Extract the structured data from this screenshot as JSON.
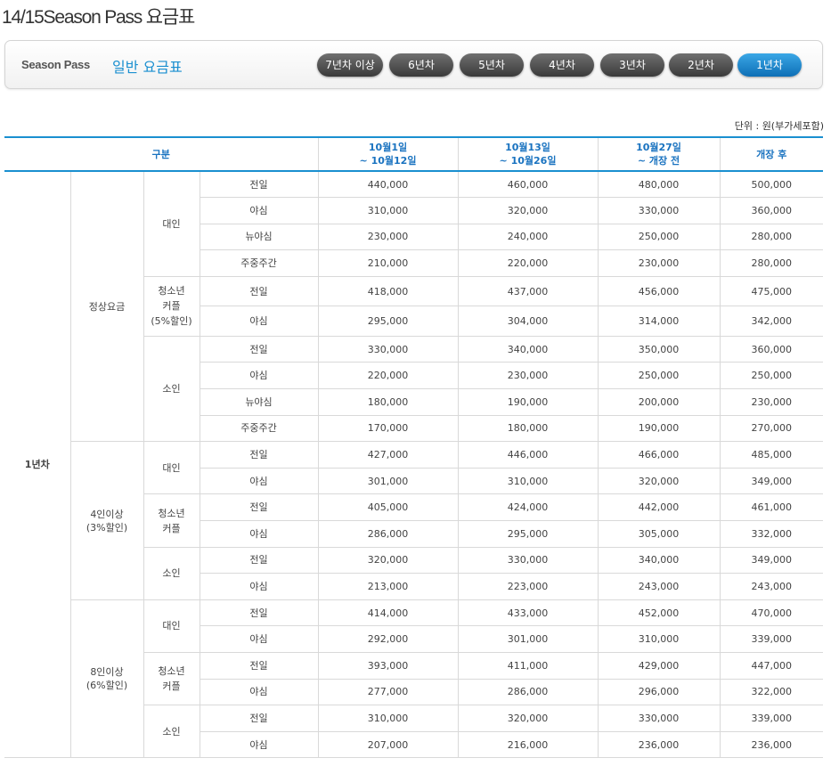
{
  "page_title": "14/15Season Pass 요금표",
  "bar": {
    "season_pass": "Season Pass",
    "title": "일반 요금표"
  },
  "tabs": [
    "7년차 이상",
    "6년차",
    "5년차",
    "4년차",
    "3년차",
    "2년차",
    "1년차"
  ],
  "active_tab": "1년차",
  "unit_note": "단위 : 원(부가세포함)",
  "headers": {
    "category": "구분",
    "p1_line1": "10월1일",
    "p1_line2": "~ 10월12일",
    "p2_line1": "10월13일",
    "p2_line2": "~ 10월26일",
    "p3_line1": "10월27일",
    "p3_line2": "~ 개장 전",
    "p4": "개장 후"
  },
  "year_label": "1년차",
  "groups": [
    {
      "label": "정상요금",
      "subgroups": [
        {
          "label": "대인",
          "rows": [
            {
              "type": "전일",
              "values": [
                "440,000",
                "460,000",
                "480,000",
                "500,000"
              ]
            },
            {
              "type": "야심",
              "values": [
                "310,000",
                "320,000",
                "330,000",
                "360,000"
              ]
            },
            {
              "type": "뉴야심",
              "values": [
                "230,000",
                "240,000",
                "250,000",
                "280,000"
              ]
            },
            {
              "type": "주중주간",
              "values": [
                "210,000",
                "220,000",
                "230,000",
                "280,000"
              ]
            }
          ]
        },
        {
          "label": "청소년\n커플\n(5%할인)",
          "rows": [
            {
              "type": "전일",
              "values": [
                "418,000",
                "437,000",
                "456,000",
                "475,000"
              ]
            },
            {
              "type": "야심",
              "values": [
                "295,000",
                "304,000",
                "314,000",
                "342,000"
              ]
            }
          ]
        },
        {
          "label": "소인",
          "rows": [
            {
              "type": "전일",
              "values": [
                "330,000",
                "340,000",
                "350,000",
                "360,000"
              ]
            },
            {
              "type": "야심",
              "values": [
                "220,000",
                "230,000",
                "250,000",
                "250,000"
              ]
            },
            {
              "type": "뉴야심",
              "values": [
                "180,000",
                "190,000",
                "200,000",
                "230,000"
              ]
            },
            {
              "type": "주중주간",
              "values": [
                "170,000",
                "180,000",
                "190,000",
                "270,000"
              ]
            }
          ]
        }
      ]
    },
    {
      "label": "4인이상\n(3%할인)",
      "subgroups": [
        {
          "label": "대인",
          "rows": [
            {
              "type": "전일",
              "values": [
                "427,000",
                "446,000",
                "466,000",
                "485,000"
              ]
            },
            {
              "type": "야심",
              "values": [
                "301,000",
                "310,000",
                "320,000",
                "349,000"
              ]
            }
          ]
        },
        {
          "label": "청소년\n커플",
          "rows": [
            {
              "type": "전일",
              "values": [
                "405,000",
                "424,000",
                "442,000",
                "461,000"
              ]
            },
            {
              "type": "야심",
              "values": [
                "286,000",
                "295,000",
                "305,000",
                "332,000"
              ]
            }
          ]
        },
        {
          "label": "소인",
          "rows": [
            {
              "type": "전일",
              "values": [
                "320,000",
                "330,000",
                "340,000",
                "349,000"
              ]
            },
            {
              "type": "야심",
              "values": [
                "213,000",
                "223,000",
                "243,000",
                "243,000"
              ]
            }
          ]
        }
      ]
    },
    {
      "label": "8인이상\n(6%할인)",
      "subgroups": [
        {
          "label": "대인",
          "rows": [
            {
              "type": "전일",
              "values": [
                "414,000",
                "433,000",
                "452,000",
                "470,000"
              ]
            },
            {
              "type": "야심",
              "values": [
                "292,000",
                "301,000",
                "310,000",
                "339,000"
              ]
            }
          ]
        },
        {
          "label": "청소년\n커플",
          "rows": [
            {
              "type": "전일",
              "values": [
                "393,000",
                "411,000",
                "429,000",
                "447,000"
              ]
            },
            {
              "type": "야심",
              "values": [
                "277,000",
                "286,000",
                "296,000",
                "322,000"
              ]
            }
          ]
        },
        {
          "label": "소인",
          "rows": [
            {
              "type": "전일",
              "values": [
                "310,000",
                "320,000",
                "330,000",
                "339,000"
              ]
            },
            {
              "type": "야심",
              "values": [
                "207,000",
                "216,000",
                "236,000",
                "236,000"
              ]
            }
          ]
        }
      ]
    }
  ],
  "colors": {
    "accent": "#1a8fd0",
    "tab_dark": "#4a4a4a",
    "header_text": "#1a73c0"
  }
}
